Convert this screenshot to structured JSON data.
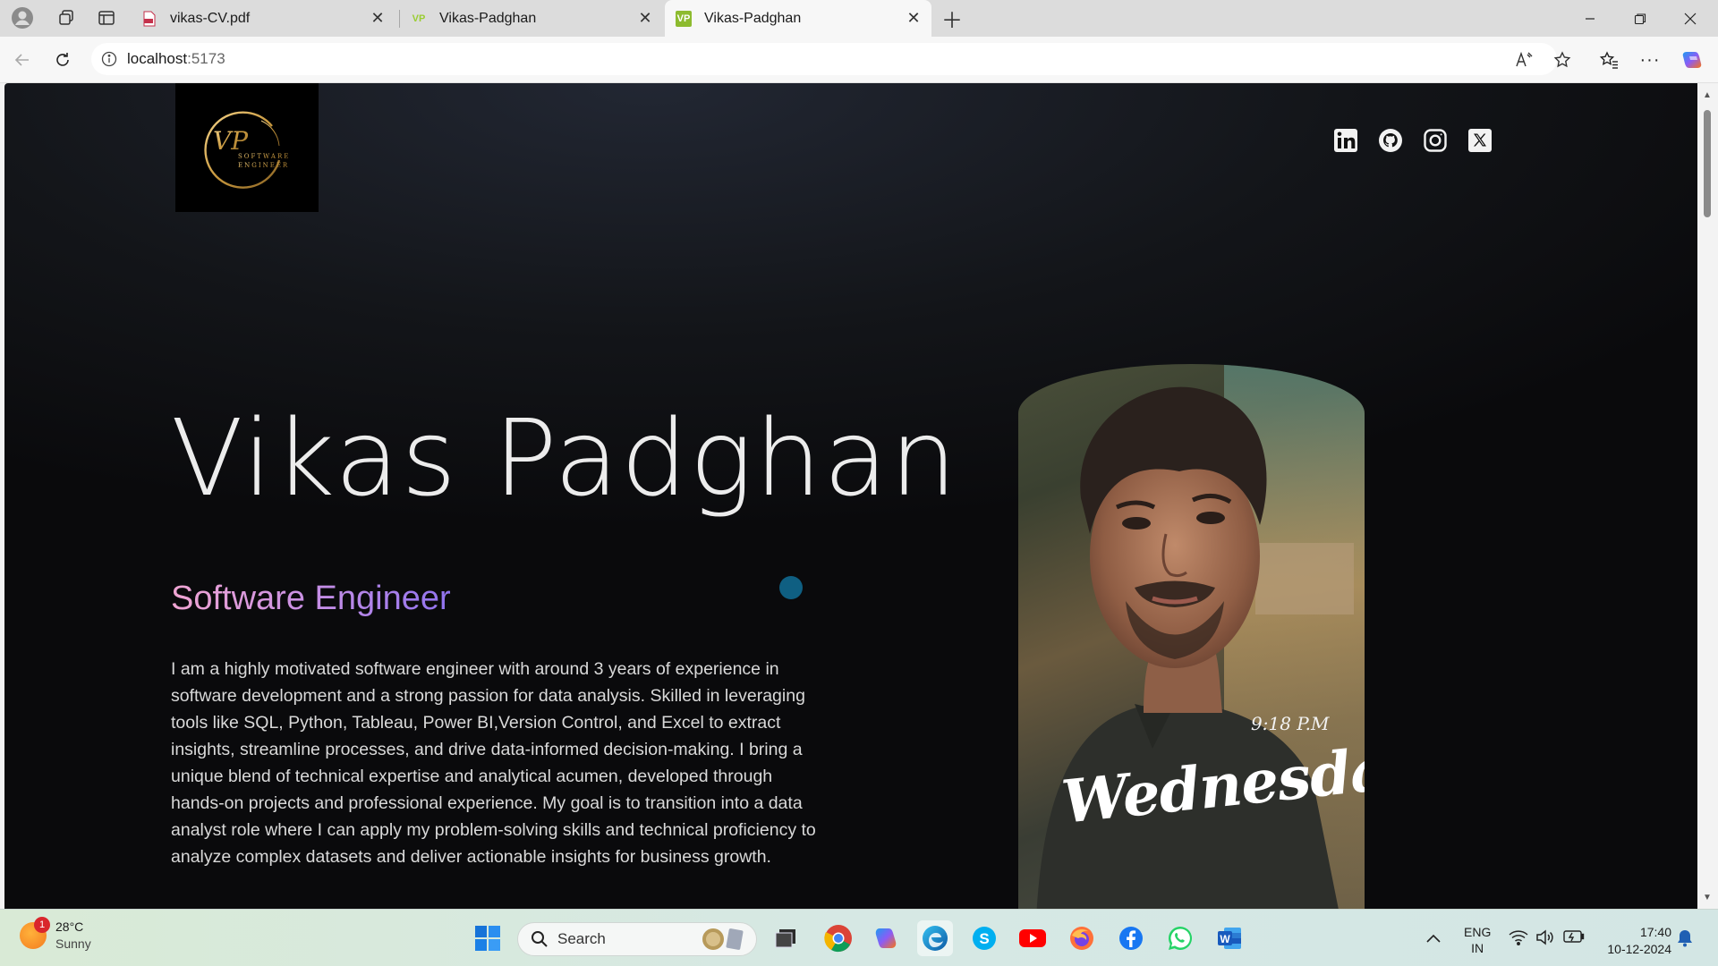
{
  "browser": {
    "tabs": [
      {
        "title": "vikas-CV.pdf",
        "favicon": "pdf-icon",
        "active": false
      },
      {
        "title": "Vikas-Padghan",
        "favicon": "VP",
        "active": false
      },
      {
        "title": "Vikas-Padghan",
        "favicon": "VP",
        "active": true
      }
    ],
    "url_host": "localhost",
    "url_port": ":5173"
  },
  "page": {
    "logo": {
      "monogram": "VP",
      "tagline_1": "SOFTWARE",
      "tagline_2": "ENGINEER"
    },
    "socials": [
      "linkedin-icon",
      "github-icon",
      "instagram-icon",
      "x-icon"
    ],
    "hero_name": "Vikas Padghan",
    "role": "Software Engineer",
    "bio": "I am a highly motivated software engineer with around 3 years of experience in software development and a strong passion for data analysis. Skilled in leveraging tools like SQL, Python, Tableau, Power BI,Version Control, and Excel to extract insights, streamline processes, and drive data-informed decision-making. I bring a unique blend of technical expertise and analytical acumen, developed through hands-on projects and professional experience. My goal is to transition into a data analyst role where I can apply my problem-solving skills and technical proficiency to analyze complex datasets and deliver actionable insights for business growth.",
    "photo_overlay_time": "9:18 P.M",
    "photo_overlay_day": "Wednesday"
  },
  "taskbar": {
    "weather_temp": "28°C",
    "weather_cond": "Sunny",
    "weather_badge": "1",
    "search_label": "Search",
    "lang_1": "ENG",
    "lang_2": "IN",
    "time": "17:40",
    "date": "10-12-2024"
  }
}
